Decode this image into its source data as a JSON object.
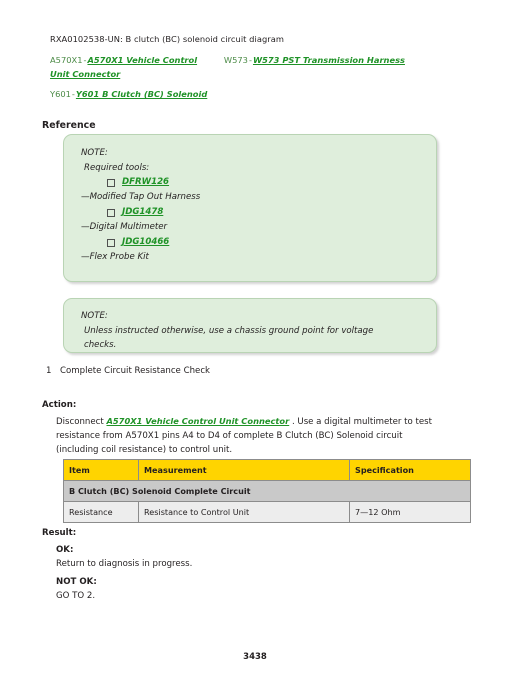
{
  "figure": {
    "caption": "RXA0102538-UN: B clutch (BC) solenoid circuit diagram"
  },
  "legend": {
    "items": [
      {
        "tag": "A570X1",
        "separator": "-",
        "link": "A570X1 Vehicle Control Unit Connector"
      },
      {
        "tag": "W573",
        "separator": "-",
        "link": "W573 PST Transmission Harness"
      },
      {
        "tag": "Y601",
        "separator": "-",
        "link": "Y601 B Clutch (BC) Solenoid"
      }
    ]
  },
  "reference": {
    "heading": "Reference",
    "note_tools": {
      "label": "NOTE:",
      "intro": "Required tools:",
      "entries": [
        {
          "code": "DFRW126",
          "description": "—Modified Tap Out Harness"
        },
        {
          "code": "JDG1478",
          "description": "—Digital Multimeter"
        },
        {
          "code": "JDG10466",
          "description": "—Flex Probe Kit"
        }
      ]
    },
    "note_ground": {
      "label": "NOTE:",
      "line1": "Unless instructed otherwise, use a chassis ground point for voltage",
      "line2": "checks."
    }
  },
  "step": {
    "number": "1",
    "title": "Complete Circuit Resistance Check"
  },
  "action": {
    "label": "Action:",
    "prefix": "Disconnect",
    "link": "A570X1 Vehicle Control Unit Connector",
    "suffix": ". Use a digital multimeter to test resistance from A570X1 pins A4 to D4 of complete B Clutch (BC) Solenoid circuit (including coil resistance) to control unit."
  },
  "table": {
    "headers": [
      "Item",
      "Measurement",
      "Specification"
    ],
    "group_row": "B Clutch (BC) Solenoid Complete Circuit",
    "rows": [
      [
        "Resistance",
        "Resistance to Control Unit",
        "7—12 Ohm"
      ]
    ]
  },
  "result": {
    "label": "Result:",
    "ok_label": "OK:",
    "ok_text": "Return to diagnosis in progress.",
    "not_ok_label": "NOT OK:",
    "not_ok_text": "GO TO 2."
  },
  "footer": {
    "page_number": "3438"
  },
  "colors": {
    "link_green": "#1f9227",
    "tag_green": "#4c8b47",
    "note_bg": "#dfeedc",
    "note_border": "#b9d4b4",
    "table_header": "#ffd400",
    "table_group": "#c9c9c9",
    "table_row": "#ededed"
  }
}
